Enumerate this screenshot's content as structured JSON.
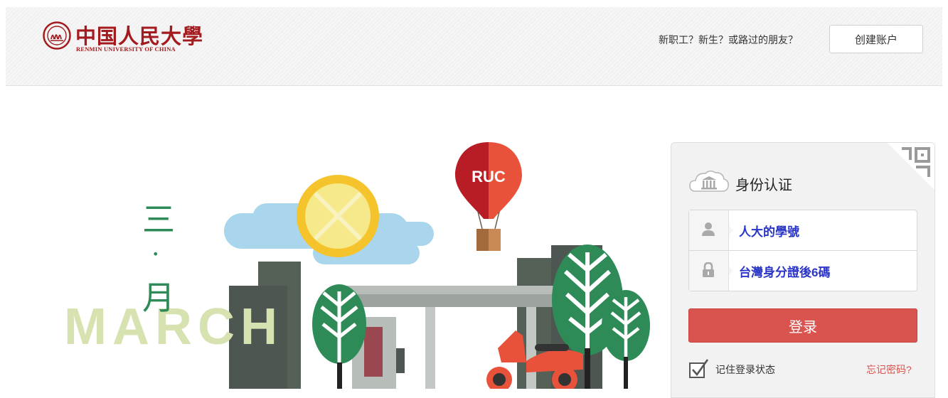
{
  "header": {
    "logo_cn": "中国人民大學",
    "logo_en": "RENMIN UNIVERSITY OF CHINA",
    "newcomer_text": "新职工？新生？或路过的朋友？",
    "create_account_label": "创建账户"
  },
  "banner": {
    "month_cn": [
      "三",
      "·",
      "月"
    ],
    "month_en": "MARCH",
    "balloon_text": "RUC"
  },
  "login": {
    "title": "身份认证",
    "username_value": "人大的學號",
    "password_value": "台灣身分證後6碼",
    "submit_label": "登录",
    "remember_label": "记住登录状态",
    "remember_checked": true,
    "forgot_label": "忘记密码?"
  },
  "colors": {
    "brand_red": "#a31b1e",
    "button_red": "#d9534f",
    "input_blue": "#2a35c8",
    "tree_green": "#2e8b57",
    "march_green": "#d6e3b0"
  }
}
